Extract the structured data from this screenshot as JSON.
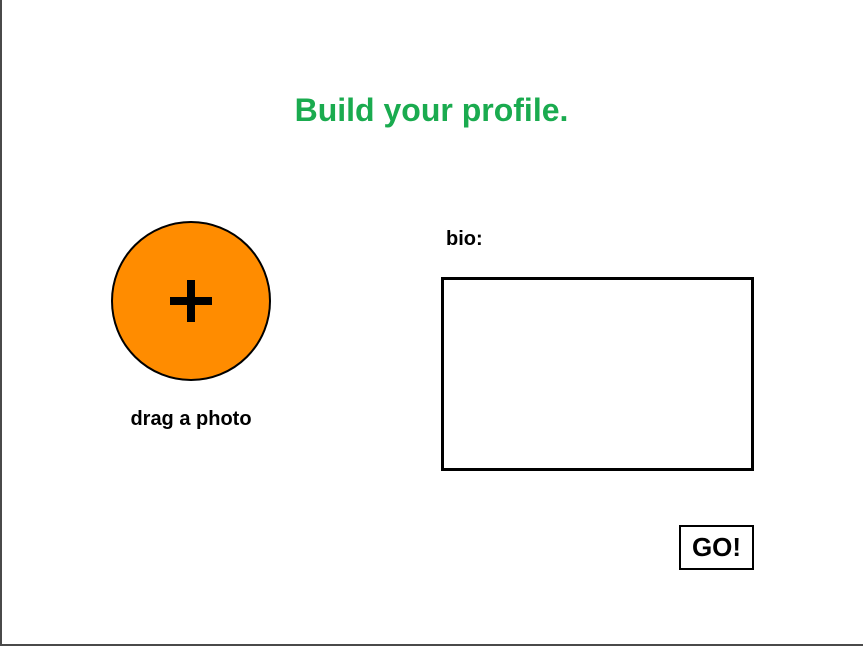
{
  "header": {
    "title": "Build your profile."
  },
  "photo_upload": {
    "icon": "plus-icon",
    "caption": "drag a photo"
  },
  "bio": {
    "label": "bio:",
    "value": ""
  },
  "actions": {
    "go_label": "GO!"
  },
  "colors": {
    "title": "#1aab4f",
    "photo_fill": "#ff8c00",
    "border": "#000000",
    "background": "#ffffff"
  }
}
